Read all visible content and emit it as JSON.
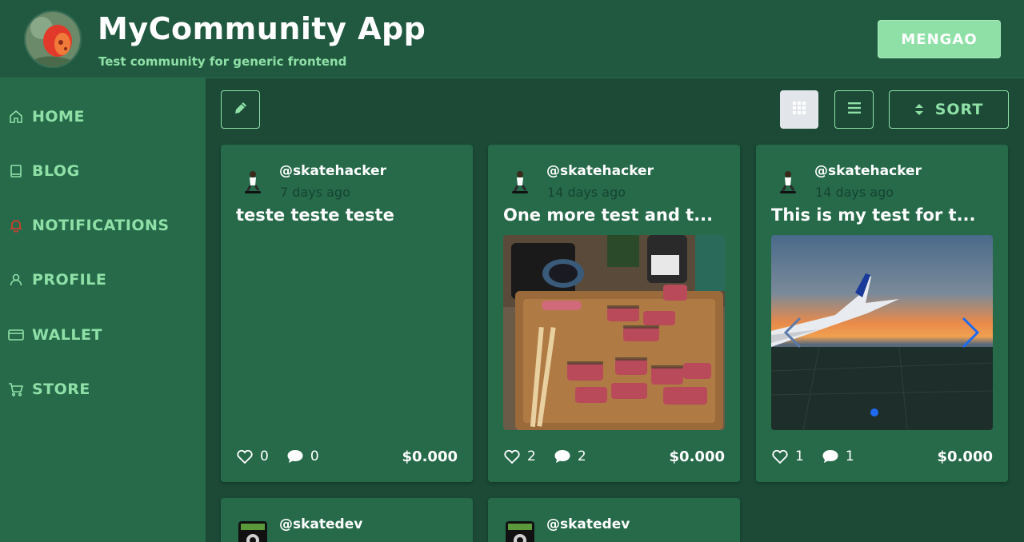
{
  "header": {
    "title": "MyCommunity App",
    "subtitle": "Test community for generic frontend",
    "user_button": "MENGAO"
  },
  "sidebar": {
    "items": [
      {
        "label": "HOME",
        "icon": "home-icon"
      },
      {
        "label": "BLOG",
        "icon": "book-icon"
      },
      {
        "label": "NOTIFICATIONS",
        "icon": "bell-icon"
      },
      {
        "label": "PROFILE",
        "icon": "user-icon"
      },
      {
        "label": "WALLET",
        "icon": "credit-card-icon"
      },
      {
        "label": "STORE",
        "icon": "cart-icon"
      }
    ]
  },
  "toolbar": {
    "edit_icon": "pencil-icon",
    "grid_icon": "grid-icon",
    "list_icon": "list-icon",
    "sort_label": "SORT"
  },
  "posts": [
    {
      "author": "@skatehacker",
      "time": "7 days ago",
      "title": "teste teste teste",
      "likes": "0",
      "comments": "0",
      "payout": "$0.000"
    },
    {
      "author": "@skatehacker",
      "time": "14 days ago",
      "title": "One more test and t...",
      "likes": "2",
      "comments": "2",
      "payout": "$0.000"
    },
    {
      "author": "@skatehacker",
      "time": "14 days ago",
      "title": "This is my test for t...",
      "likes": "1",
      "comments": "1",
      "payout": "$0.000"
    },
    {
      "author": "@skatedev"
    },
    {
      "author": "@skatedev"
    }
  ],
  "colors": {
    "accent": "#8fe0a7",
    "header_bg": "#20593f",
    "sidebar_bg": "#266a4a",
    "main_bg": "#1c4a37",
    "card_bg": "#266a4a"
  }
}
